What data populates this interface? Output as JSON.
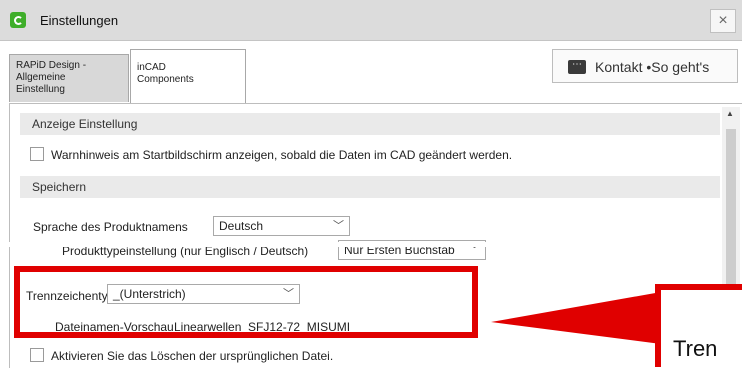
{
  "window": {
    "title": "Einstellungen",
    "close_glyph": "×"
  },
  "tabs": [
    {
      "label": "RAPiD Design -\nAllgemeine\nEinstellung"
    },
    {
      "label": "inCAD\nComponents"
    }
  ],
  "contact": {
    "label": "Kontakt •So geht's",
    "icon": "chat-icon"
  },
  "sections": {
    "display": "Anzeige Einstellung",
    "save": "Speichern"
  },
  "settings": {
    "warning_checkbox_label": "Warnhinweis am Startbildschirm anzeigen, sobald die Daten im CAD geändert werden.",
    "product_lang_label": "Sprache des Produktnamens",
    "product_lang_value": "Deutsch",
    "product_type_label": "Produkttypeinstellung (nur Englisch / Deutsch)",
    "product_type_value": "Nur Ersten Buchstab",
    "separator_label": "Trennzeichentyp",
    "separator_value": "_(Unterstrich)",
    "preview_label": "Dateinamen-Vorschau",
    "preview_value": "Linearwellen_SFJ12-72_MISUMI",
    "delete_checkbox_label": "Aktivieren Sie das Löschen der ursprünglichen Datei."
  },
  "callout": {
    "text": "Tren"
  },
  "colors": {
    "highlight": "#e00000",
    "app_icon": "#3fae2a"
  }
}
